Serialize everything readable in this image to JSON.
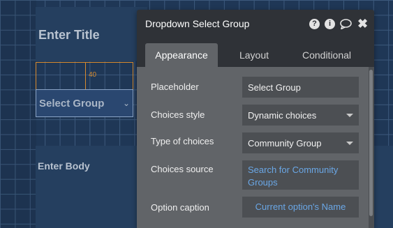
{
  "canvas": {
    "title_placeholder": "Enter Title",
    "spacer_value": "40",
    "select_group_label": "Select Group",
    "body_placeholder": "Enter Body"
  },
  "dialog": {
    "title": "Dropdown Select Group",
    "header_icons": [
      "help-icon",
      "info-icon",
      "comment-icon",
      "close-icon"
    ],
    "tabs": [
      {
        "label": "Appearance",
        "active": true
      },
      {
        "label": "Layout",
        "active": false
      },
      {
        "label": "Conditional",
        "active": false
      }
    ],
    "fields": {
      "placeholder": {
        "label": "Placeholder",
        "value": "Select Group"
      },
      "choices_style": {
        "label": "Choices style",
        "value": "Dynamic choices"
      },
      "type_of_choices": {
        "label": "Type of choices",
        "value": "Community Group"
      },
      "choices_source": {
        "label": "Choices source",
        "value": "Search for Community Groups"
      },
      "option_caption": {
        "label": "Option caption",
        "value": "Current option's Name"
      }
    }
  },
  "colors": {
    "canvas_bg": "#1f3756",
    "dialog_bg": "#2f3237",
    "panel_bg": "#616468",
    "link": "#6aa7e6",
    "spacer": "#d88a2d"
  }
}
